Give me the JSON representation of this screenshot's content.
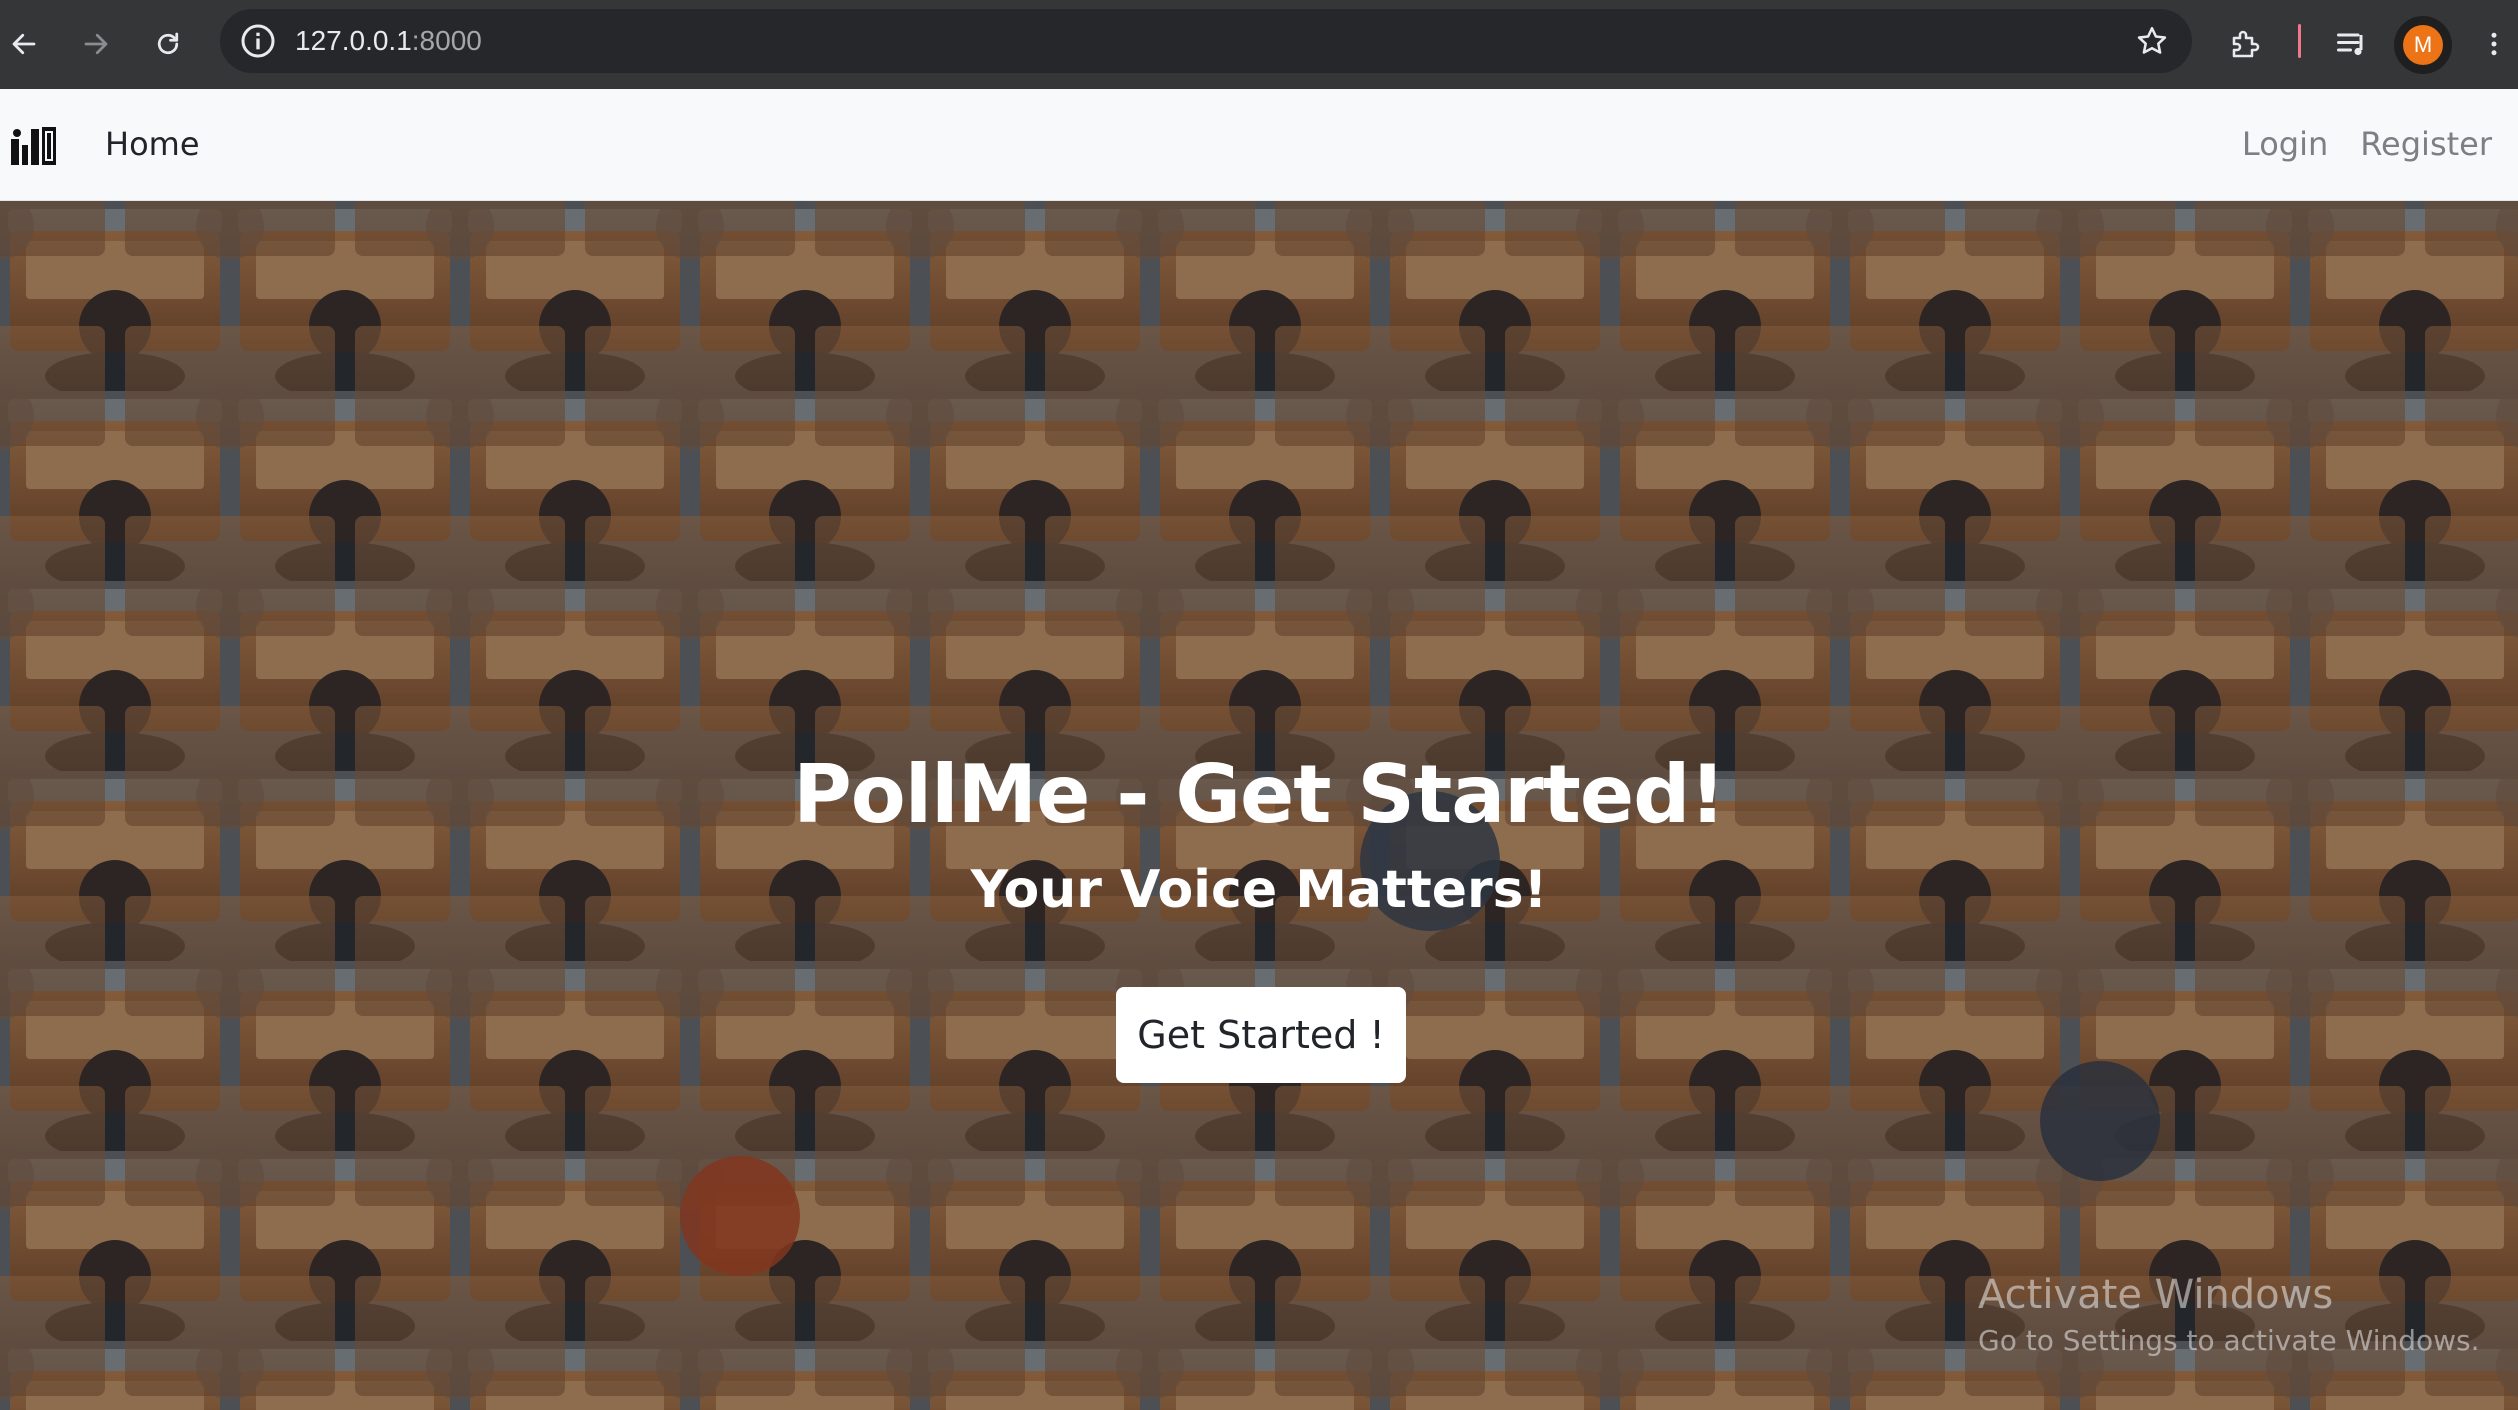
{
  "browser": {
    "address_host": "127.0.0.1",
    "address_port": ":8000",
    "avatar_letter": "M",
    "accent_color": "#ec7316",
    "icons": [
      "back-arrow-icon",
      "forward-arrow-icon",
      "reload-icon",
      "site-info-icon",
      "bookmark-star-icon",
      "extensions-icon",
      "reading-list-icon",
      "menu-dots-icon"
    ]
  },
  "navbar": {
    "brand_icon": "poll-logo-icon",
    "home_label": "Home",
    "login_label": "Login",
    "register_label": "Register"
  },
  "hero": {
    "title": "PollMe - Get Started!",
    "subtitle": "Your Voice Matters!",
    "cta_label": "Get Started !",
    "background": "lecture-hall-audience-photo"
  },
  "watermark": {
    "line1": "Activate Windows",
    "line2": "Go to Settings to activate Windows."
  }
}
